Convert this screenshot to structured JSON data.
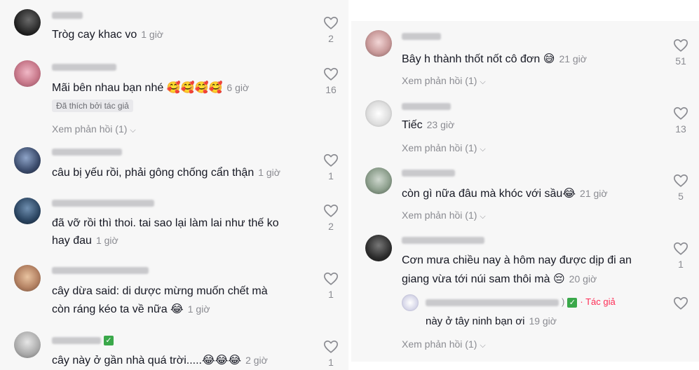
{
  "left": {
    "comments": [
      {
        "text": "Tròg cay khac vo",
        "time": "1 giờ",
        "likes": "2"
      },
      {
        "text": "Mãi bên nhau bạn nhé",
        "emoji": "🥰🥰🥰🥰",
        "time": "6 giờ",
        "likes": "16",
        "badge": "Đã thích bởi tác giả",
        "replies": "Xem phản hồi (1)"
      },
      {
        "text": "câu bị yếu rồi, phải gông chống cẩn thận",
        "time": "1 giờ",
        "likes": "1"
      },
      {
        "text_line1": "đã vỡ rồi thì thoi. tai sao lại làm lai như thế ko",
        "text_line2": "hay đau",
        "time": "1 giờ",
        "likes": "2"
      },
      {
        "text_line1": "cây dừa said: di dược mừng muốn chết mà",
        "text_line2": "còn ráng kéo ta về nữa",
        "emoji": "😂",
        "time": "1 giờ",
        "likes": "1"
      },
      {
        "text": "cây này ở gần nhà quá trời.....",
        "emoji": "😂😂😂",
        "time": "2 giờ",
        "likes": "1"
      }
    ]
  },
  "right": {
    "comments": [
      {
        "text": "Bây h thành thốt nốt cô đơn",
        "emoji": "😅",
        "time": "21 giờ",
        "likes": "51",
        "replies": "Xem phản hồi (1)"
      },
      {
        "text": "Tiếc",
        "time": "23 giờ",
        "likes": "13",
        "replies": "Xem phản hồi (1)"
      },
      {
        "text": "còn gì nữa đâu mà khóc với sầu",
        "emoji": "😂",
        "time": "21 giờ",
        "likes": "5",
        "replies": "Xem phản hồi (1)"
      },
      {
        "text_line1": "Cơn mưa chiều nay à hôm nay được dịp đi an",
        "text_line2": "giang vừa tới núi sam thôi mà",
        "emoji": "😔",
        "time": "20 giờ",
        "likes": "1"
      }
    ],
    "reply": {
      "suffix": ")",
      "author_label": "Tác giả",
      "text": "này ở tây ninh bạn ơi",
      "time": "19 giờ"
    },
    "more_replies": "Xem phản hồi (1)"
  },
  "icons": {
    "like": "heart-outline-icon",
    "expand": "chevron-down-icon",
    "verified": "green-check-icon"
  },
  "colors": {
    "author": "#fe2c55",
    "muted": "#8a8b91",
    "text": "#161823",
    "panel_bg": "#f7f7f7"
  }
}
